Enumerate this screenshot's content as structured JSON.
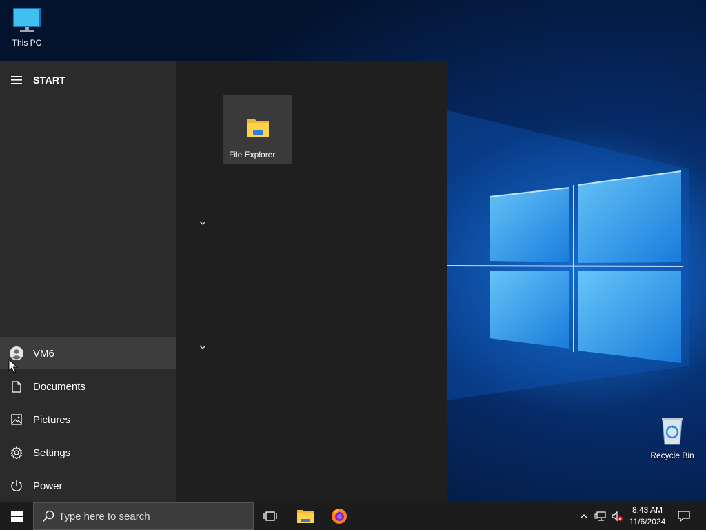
{
  "desktop": {
    "icons": [
      {
        "label": "This PC",
        "icon": "monitor-icon"
      },
      {
        "label": "Recycle Bin",
        "icon": "recycle-bin-icon"
      }
    ]
  },
  "start_menu": {
    "title": "START",
    "user": {
      "name": "VM6"
    },
    "nav_items": [
      {
        "label": "Documents",
        "icon": "document-icon"
      },
      {
        "label": "Pictures",
        "icon": "pictures-icon"
      },
      {
        "label": "Settings",
        "icon": "gear-icon"
      },
      {
        "label": "Power",
        "icon": "power-icon"
      }
    ],
    "tiles": [
      {
        "label": "File Explorer",
        "icon": "folder-icon"
      }
    ]
  },
  "taskbar": {
    "search_placeholder": "Type here to search",
    "clock": {
      "time": "8:43 AM",
      "date": "11/6/2024"
    }
  },
  "colors": {
    "start_left_bg": "#2b2b2b",
    "start_right_bg": "#1f1f1f",
    "taskbar_bg": "#1c1c1c",
    "accent_blue": "#1e90ff"
  }
}
